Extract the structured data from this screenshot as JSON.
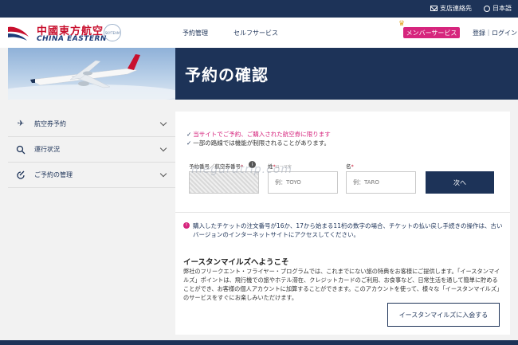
{
  "topbar": {
    "contact": "支店連絡先",
    "language": "日本語"
  },
  "header": {
    "logo_cn": "中國東方航空",
    "logo_en": "CHINA EASTERN",
    "skyteam": "SKYTEAM",
    "nav": [
      "予約管理",
      "セルフサービス"
    ],
    "member_button": "メンバーサービス",
    "login": "登録｜ログイン"
  },
  "hero": {
    "title": "予約の確認"
  },
  "sidebar": {
    "items": [
      {
        "label": "航空券予約",
        "icon": "plane-icon"
      },
      {
        "label": "運行状況",
        "icon": "search-icon"
      },
      {
        "label": "ご予約の管理",
        "icon": "manage-icon"
      }
    ]
  },
  "form": {
    "notices": [
      "当サイトでご予約、ご購入された航空券に限ります",
      "一部の路線では機能が制限されることがあります。"
    ],
    "booking_label": "予約番号／航空券番号",
    "surname_label": "姓",
    "surname_sub": "ローマ字",
    "given_label": "名",
    "surname_placeholder": "例：TOYO",
    "given_placeholder": "例：TARO",
    "next_button": "次へ"
  },
  "warning": "購入したチケットの注文番号が16か、17から始まる11桁の数字の場合、チケットの払い戻し手続きの操作は、古いバージョンのインターネットサイトにアクセスしてください。",
  "miles": {
    "title": "イースタンマイルズへようこそ",
    "body": "弊社のフリークエント・フライヤー・プログラムでは、これまでにない旅の特典をお客様にご提供します。「イースタンマイルズ」ポイントは、飛行機での旅やホテル滞在、クレジットカードのご利用、お食事など、日常生活を通して簡単に貯めることができ、お客様の個人アカウントに加算することができます。このアカウントを使って、様々な「イースタンマイルズ」のサービスをすぐにお楽しみいただけます。",
    "join_button": "イースタンマイルズに入会する"
  },
  "watermark": "megurutrip.com",
  "colors": {
    "navy": "#1d3358",
    "pink": "#d6257d",
    "brand_red": "#c8102e"
  }
}
